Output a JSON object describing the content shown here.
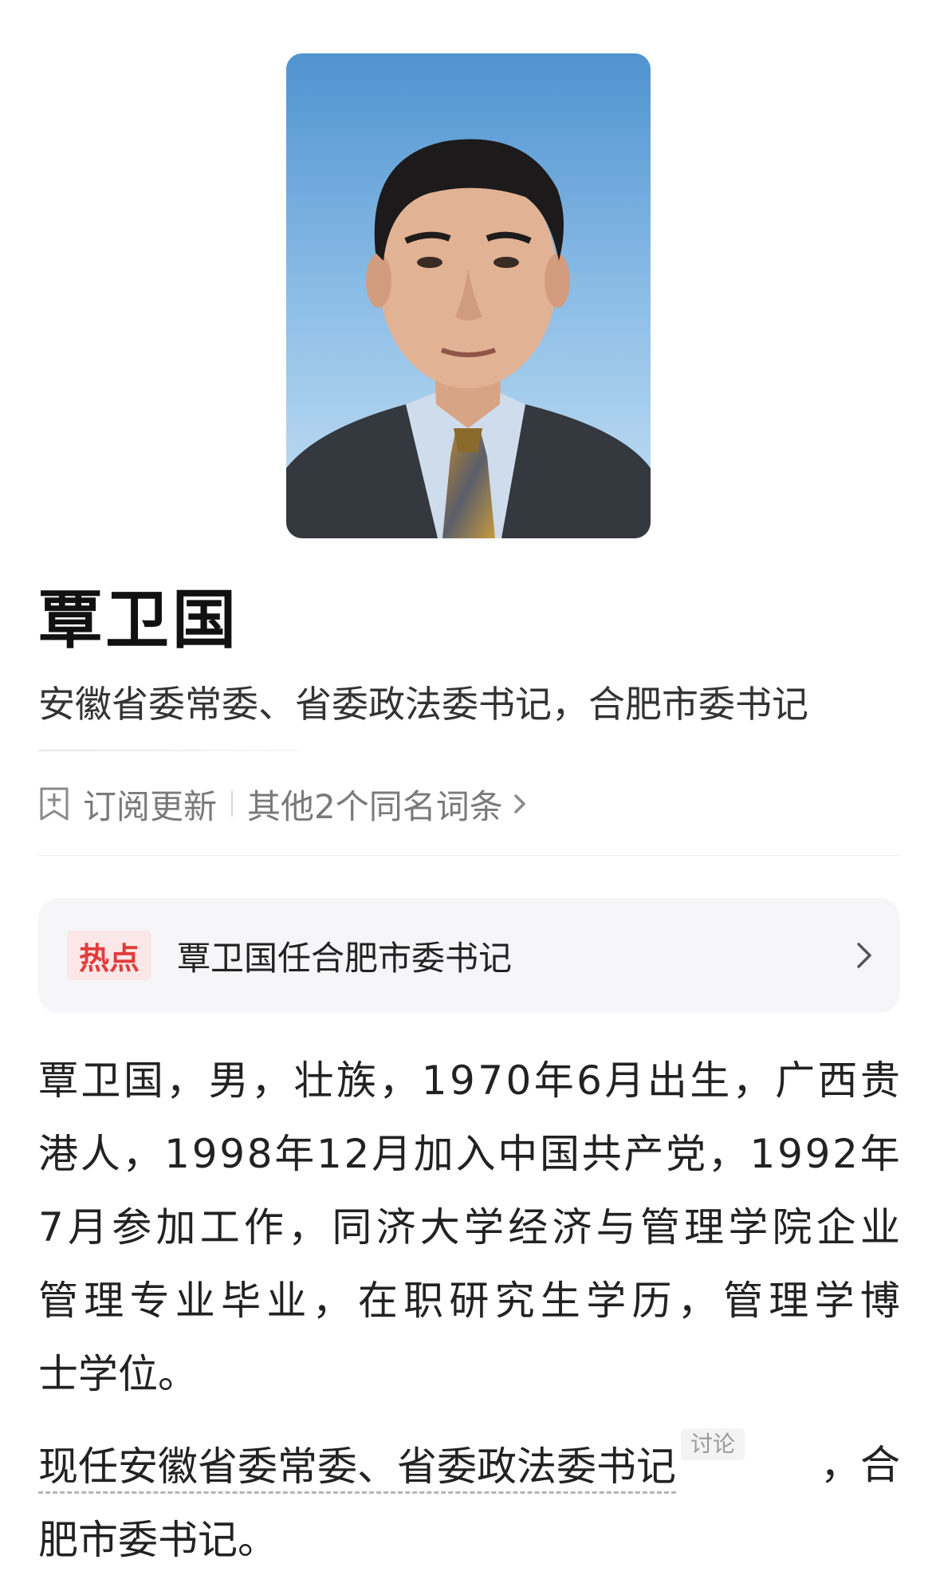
{
  "portrait": {
    "alt": "person-portrait"
  },
  "header": {
    "name": "覃卫国",
    "subtitle": "安徽省委常委、省委政法委书记，合肥市委书记"
  },
  "actions": {
    "subscribe_label": "订阅更新",
    "same_name_label": "其他2个同名词条"
  },
  "hot": {
    "badge": "热点",
    "title": "覃卫国任合肥市委书记"
  },
  "intro": {
    "lines": [
      "覃卫国，男，壮族，1970年6月出生，广西贵",
      "港人，1998年12月加入中国共产党，1992年",
      "7月参加工作，同济大学经济与管理学院企业",
      "管理专业毕业，在职研究生学历，管理学博",
      "士学位。"
    ]
  },
  "current": {
    "linked_text": "现任安徽省委常委、省委政法委书记",
    "discuss_tag": "讨论",
    "rest_line1": "，合",
    "line2": "肥市委书记。"
  },
  "colors": {
    "hot_badge_bg": "#fbe7e7",
    "hot_badge_text": "#e23b3b",
    "card_bg": "#f6f6f8",
    "muted_text": "#7a7a7a"
  },
  "icons": {
    "subscribe": "subscribe-icon",
    "same_name_arrow": "chevron-right-icon",
    "hot_arrow": "chevron-right-icon"
  }
}
